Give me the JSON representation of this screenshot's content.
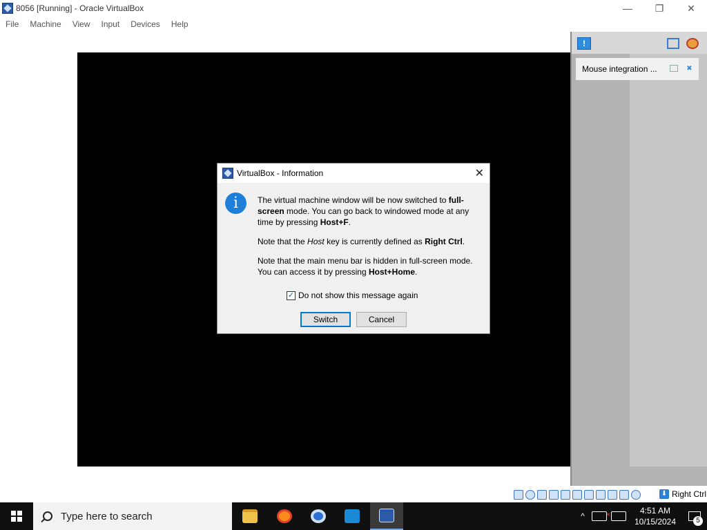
{
  "window": {
    "title": "8056 [Running] - Oracle VirtualBox",
    "minimize": "—",
    "restore": "❐",
    "close": "✕"
  },
  "menu": {
    "items": [
      "File",
      "Machine",
      "View",
      "Input",
      "Devices",
      "Help"
    ]
  },
  "notification_panel": {
    "item_label": "Mouse integration ..."
  },
  "dialog": {
    "title": "VirtualBox - Information",
    "close": "✕",
    "info_icon": "i",
    "p1_a": "The virtual machine window will be now switched to ",
    "p1_b": "full-screen",
    "p1_c": " mode. You can go back to windowed mode at any time by pressing ",
    "p1_d": "Host+F",
    "p1_e": ".",
    "p2_a": "Note that the ",
    "p2_b": "Host",
    "p2_c": " key is currently defined as ",
    "p2_d": "Right Ctrl",
    "p2_e": ".",
    "p3_a": "Note that the main menu bar is hidden in full-screen mode. You can access it by pressing ",
    "p3_b": "Host+Home",
    "p3_c": ".",
    "checkbox_label": "Do not show this message again",
    "checkbox_checked": true,
    "check_mark": "✓",
    "switch_label": "Switch",
    "cancel_label": "Cancel"
  },
  "statusbar": {
    "host_key": "Right Ctrl",
    "host_arrow": "⬇"
  },
  "taskbar": {
    "search_placeholder": "Type here to search",
    "tray_chevron": "^",
    "time": "4:51 AM",
    "date": "10/15/2024",
    "notification_count": "5"
  }
}
